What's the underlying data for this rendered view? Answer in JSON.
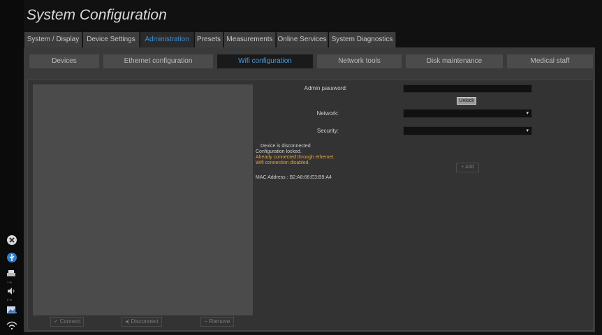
{
  "title": "System Configuration",
  "main_tabs": [
    {
      "label": "System / Display"
    },
    {
      "label": "Device Settings"
    },
    {
      "label": "Administration"
    },
    {
      "label": "Presets"
    },
    {
      "label": "Measurements"
    },
    {
      "label": "Online Services"
    },
    {
      "label": "System Diagnostics"
    }
  ],
  "sub_tabs": [
    {
      "label": "Devices"
    },
    {
      "label": "Ethernet configuration"
    },
    {
      "label": "Wifi configuration"
    },
    {
      "label": "Network tools"
    },
    {
      "label": "Disk maintenance"
    },
    {
      "label": "Medical staff"
    }
  ],
  "active_main_tab": "Administration",
  "active_sub_tab": "Wifi configuration",
  "form": {
    "admin_password_label": "Admin password:",
    "admin_password_value": "",
    "unlock_label": "Unlock",
    "network_label": "Network:",
    "network_value": "",
    "security_label": "Security:",
    "security_value": ""
  },
  "status": {
    "line1": "Device is disconnected",
    "line2": "Configuration locked.",
    "line3": "Already connected through ethernet.",
    "line4": "Wifi connection disabled.",
    "warning_color": "#e8a23a"
  },
  "add_label": "Add",
  "mac_address": "MAC Address : B2:A8:66:E3:B9:A4",
  "bottom_buttons": {
    "connect": "Connect",
    "disconnect": "Disconnect",
    "remove": "Remove"
  },
  "side_status": {
    "printer_percent": "1 %",
    "volume_percent": "0 %"
  },
  "accent_color": "#3f8fd6"
}
